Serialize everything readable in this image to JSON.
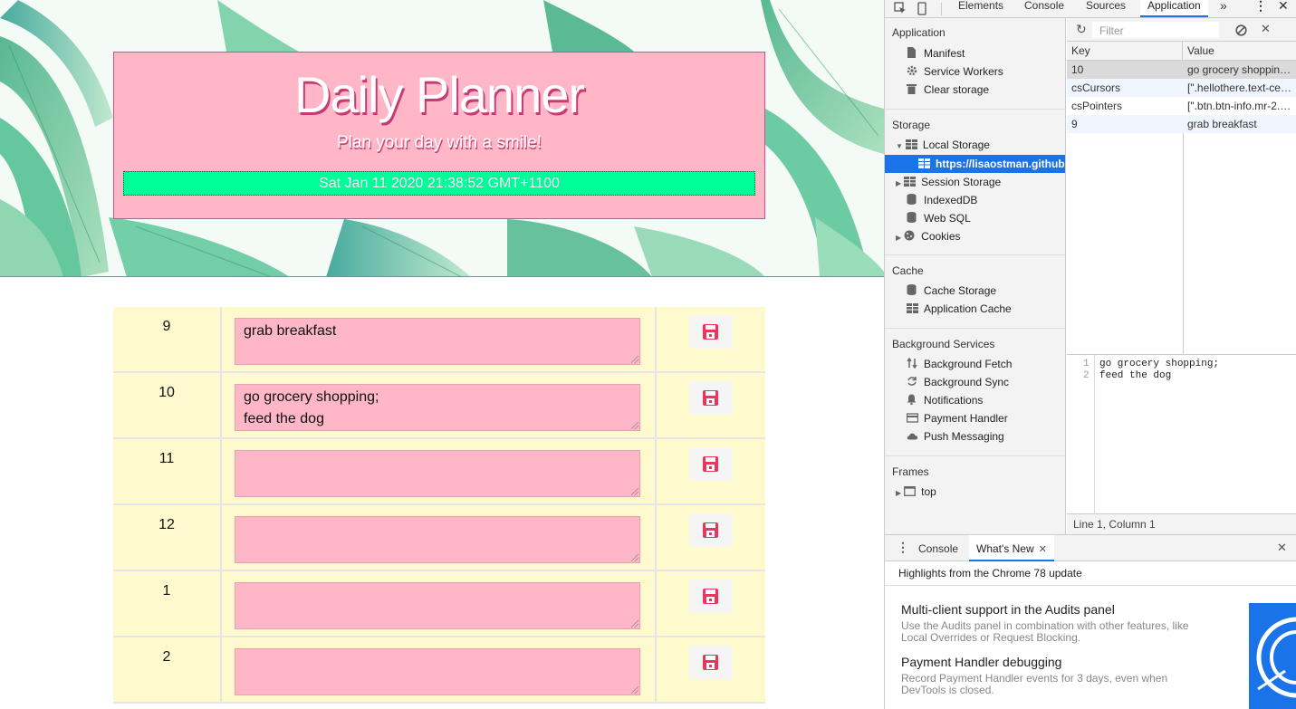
{
  "planner": {
    "title": "Daily Planner",
    "subtitle": "Plan your day with a smile!",
    "clock": "Sat Jan 11 2020 21:38:52 GMT+1100",
    "rows": [
      {
        "hour": "9",
        "task": "grab breakfast"
      },
      {
        "hour": "10",
        "task": "go grocery shopping;\nfeed the dog"
      },
      {
        "hour": "11",
        "task": ""
      },
      {
        "hour": "12",
        "task": ""
      },
      {
        "hour": "1",
        "task": ""
      },
      {
        "hour": "2",
        "task": ""
      }
    ],
    "save_icon": "floppy-disk-icon",
    "colors": {
      "header_bg": "#ffb6c6",
      "clock_bg": "#00ff99",
      "row_bg": "#fffacd",
      "task_bg": "#ffb6c6",
      "save_icon": "#e8365d"
    }
  },
  "devtools": {
    "tabs": [
      "Elements",
      "Console",
      "Sources",
      "Application"
    ],
    "active_tab": "Application",
    "more_tabs": "»",
    "sidebar": {
      "application_header": "Application",
      "application_items": [
        "Manifest",
        "Service Workers",
        "Clear storage"
      ],
      "storage_header": "Storage",
      "local_storage": "Local Storage",
      "local_storage_origin": "https://lisaostman.github.io",
      "storage_items": [
        "Session Storage",
        "IndexedDB",
        "Web SQL",
        "Cookies"
      ],
      "cache_header": "Cache",
      "cache_items": [
        "Cache Storage",
        "Application Cache"
      ],
      "background_header": "Background Services",
      "background_items": [
        "Background Fetch",
        "Background Sync",
        "Notifications",
        "Payment Handler",
        "Push Messaging"
      ],
      "frames_header": "Frames",
      "frames_item": "top"
    },
    "filter_placeholder": "Filter",
    "grid": {
      "key_header": "Key",
      "value_header": "Value",
      "rows": [
        {
          "key": "10",
          "value": "go grocery shoppin…"
        },
        {
          "key": "csCursors",
          "value": "[\".hellothere.text-ce…"
        },
        {
          "key": "csPointers",
          "value": "[\".btn.btn-info.mr-2.…"
        },
        {
          "key": "9",
          "value": "grab breakfast"
        }
      ]
    },
    "preview": {
      "lines": [
        {
          "num": "1",
          "text": "go grocery shopping;"
        },
        {
          "num": "2",
          "text": "feed the dog"
        }
      ]
    },
    "status": "Line 1, Column 1",
    "drawer": {
      "tabs": [
        "Console",
        "What's New"
      ],
      "active_tab": "What's New",
      "highlights": "Highlights from the Chrome 78 update",
      "news": [
        {
          "title": "Multi-client support in the Audits panel",
          "desc": "Use the Audits panel in combination with other features, like Local Overrides or Request Blocking."
        },
        {
          "title": "Payment Handler debugging",
          "desc": "Record Payment Handler events for 3 days, even when DevTools is closed."
        }
      ]
    }
  }
}
